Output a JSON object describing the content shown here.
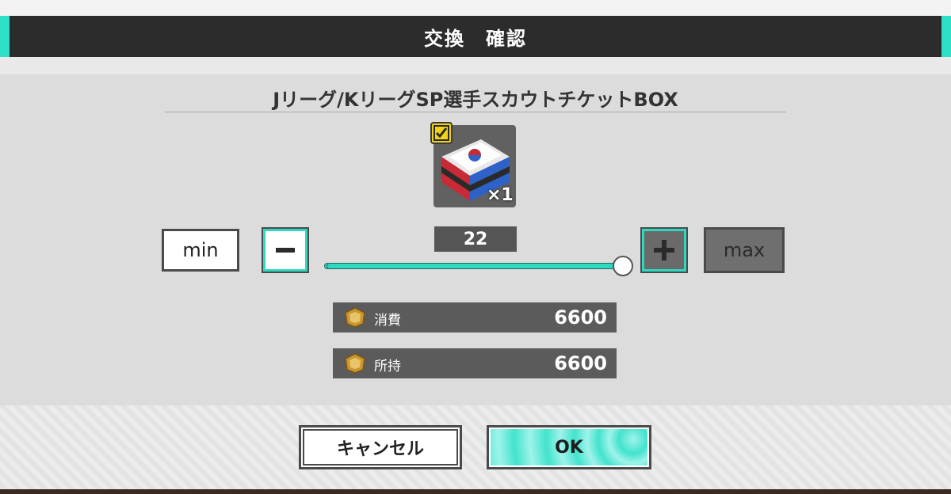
{
  "dialog": {
    "title": "交換　確認",
    "item_name": "Jリーグ/KリーグSP選手スカウトチケットBOX",
    "item_quantity": "×1",
    "icon_name": "ticket-box-icon",
    "badge_icon": "check-badge-icon"
  },
  "quantity": {
    "min_label": "min",
    "max_label": "max",
    "value": "22",
    "slider_fraction": 1.0
  },
  "costs": [
    {
      "label": "消費",
      "amount": "6600",
      "icon": "coin-icon"
    },
    {
      "label": "所持",
      "amount": "6600",
      "icon": "coin-icon"
    }
  ],
  "buttons": {
    "cancel_label": "キャンセル",
    "ok_label": "OK"
  },
  "colors": {
    "accent": "#2ee0c8",
    "header_bg": "#2c2c2c",
    "row_bg": "#5b5b5b"
  }
}
